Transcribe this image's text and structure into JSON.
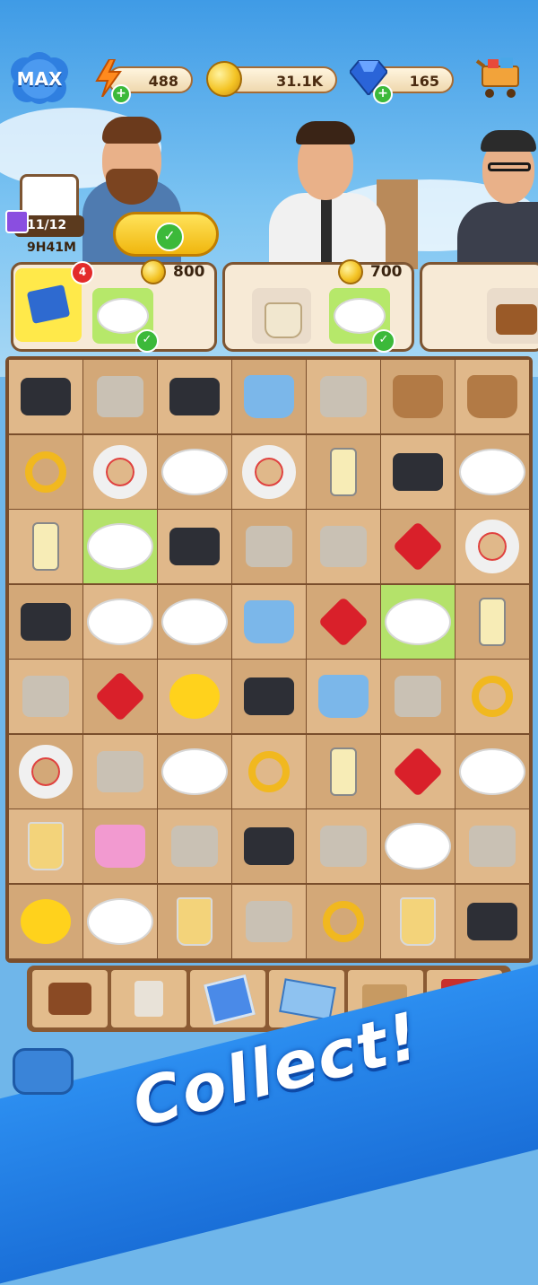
{
  "hud": {
    "level_badge": "MAX",
    "energy": "488",
    "coins": "31.1K",
    "gems": "165"
  },
  "calendar": {
    "progress": "11/12",
    "timer": "9H41M"
  },
  "orders": [
    {
      "badge_count": "4",
      "reward": "800",
      "items": [
        "shoebox-item",
        "sushi-rolls-plate"
      ]
    },
    {
      "reward": "700",
      "items": [
        "tote-bag",
        "fish-and-chips-plate"
      ]
    },
    {
      "reward": "",
      "items": [
        "brown-handbag"
      ]
    }
  ],
  "board": {
    "rows": [
      [
        "ram-sticks",
        "bikini",
        "camera-lens",
        "blue-handbag",
        "shrimp-pasta",
        "brown-purse",
        "tan-handbag"
      ],
      [
        "ruby-ring",
        "swim-ring",
        "fries-plate",
        "lifeguard-float",
        "perfume-bottles",
        "dslr-camera",
        "taco-plate"
      ],
      [
        "perfume-bottle",
        "sushi-rolls-plate",
        "black-box",
        "pink-dress",
        "roast-chicken",
        "ruby-necklace",
        "life-vest"
      ],
      [
        "picture-frame",
        "steak-plate",
        "sandwich-plate",
        "blue-tote",
        "ruby-gem",
        "fish-and-chips-plate",
        "cologne-bottle"
      ],
      [
        "napkins",
        "ruby-tiara",
        "rubber-duck",
        "computer-mouse",
        "blue-tote",
        "swim-shorts",
        "ruby-earrings"
      ],
      [
        "life-ring",
        "swim-cap",
        "burger-plate",
        "ruby-ring",
        "perfume-bottle",
        "ruby-necklace",
        "hotdog-plate"
      ],
      [
        "lemonade-glass",
        "pink-bag",
        "swim-goggles",
        "camera",
        "megaphone",
        "spaghetti-plate",
        "brown-wallet"
      ],
      [
        "rubber-duck",
        "noodle-plate",
        "bubble-tea",
        "napkins",
        "ruby-earrings",
        "iced-tea",
        "graphics-card"
      ]
    ],
    "highlighted": [
      [
        2,
        1
      ],
      [
        3,
        5
      ]
    ]
  },
  "inventory": [
    "wallet",
    "ice-block",
    "photo-frame",
    "tickets",
    "shopping-bag",
    "gift-box"
  ],
  "banner": {
    "text": "Collect!"
  },
  "colors": {
    "board_light": "#e0b88a",
    "board_dark": "#d3a878",
    "highlight": "#b4e26a",
    "banner_blue": "#1a6fd8"
  }
}
